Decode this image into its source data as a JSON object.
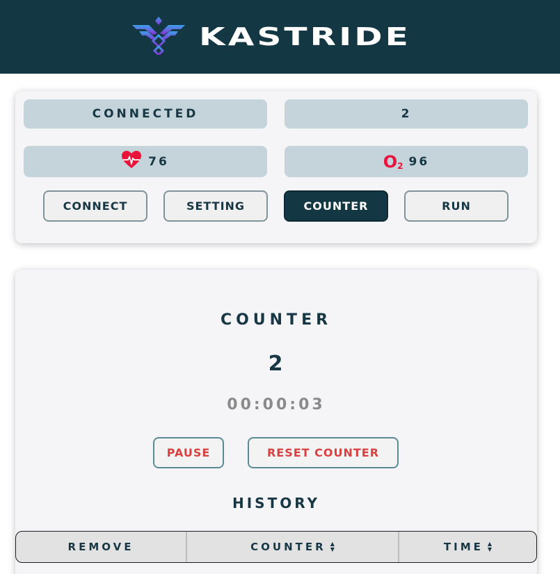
{
  "header": {
    "brand_name": "KASTRIDE",
    "logo_icon": "kastride-wing-logo-icon"
  },
  "status": {
    "connection_text": "CONNECTED",
    "count_value": "2",
    "heart_rate_icon": "heart-pulse-icon",
    "heart_rate_value": "76",
    "oxygen_label": "O",
    "oxygen_sub": "2",
    "oxygen_value": "96"
  },
  "nav": {
    "connect_label": "CONNECT",
    "setting_label": "SETTING",
    "counter_label": "COUNTER",
    "run_label": "RUN",
    "active": "COUNTER"
  },
  "counter": {
    "title": "COUNTER",
    "value": "2",
    "timer": "00:00:03",
    "pause_label": "PAUSE",
    "reset_label": "RESET COUNTER"
  },
  "history": {
    "title": "HISTORY",
    "columns": [
      "REMOVE",
      "COUNTER",
      "TIME"
    ],
    "sort_icon": "sort-up-down-icon",
    "rows": []
  },
  "colors": {
    "header_bg": "#143744",
    "pill_bg": "#c4d4da",
    "accent_red": "#e8143c",
    "danger_text": "#d94040",
    "card_bg": "#f5f5f7"
  }
}
